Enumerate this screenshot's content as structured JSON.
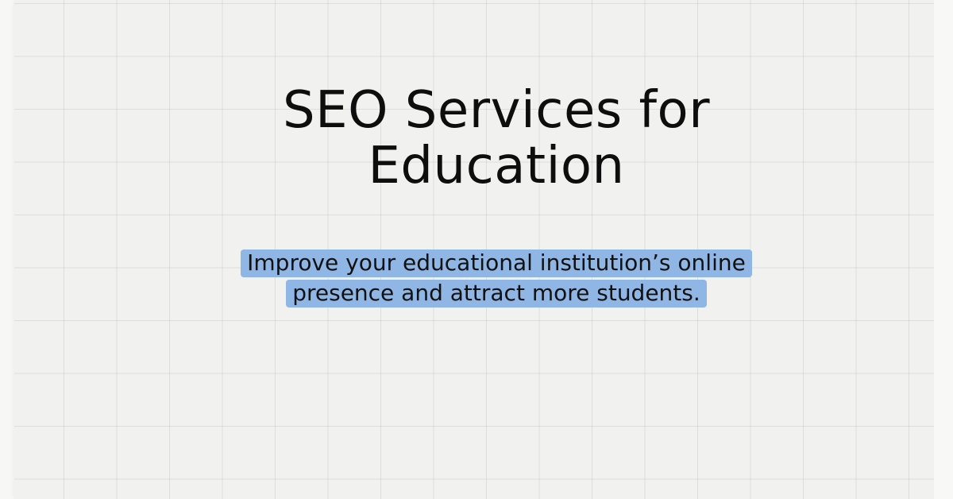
{
  "hero": {
    "title": "SEO Services for Education",
    "subtitle": "Improve your educational institution’s online presence and attract more students."
  },
  "colors": {
    "background": "#f1f1ef",
    "grid_line": "#cfcfcf",
    "highlight": "#8fb6e4",
    "text": "#0e0e0e"
  }
}
